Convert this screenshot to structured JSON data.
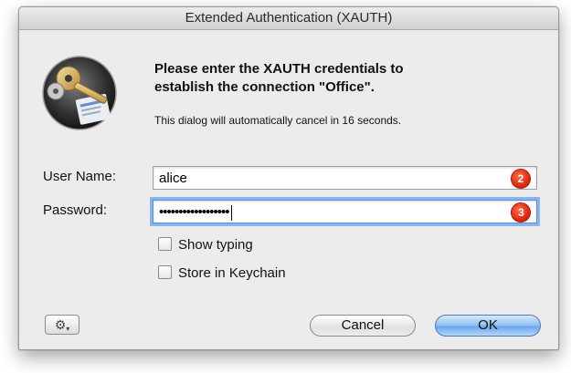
{
  "dialog": {
    "title": "Extended Authentication (XAUTH)",
    "icon": "keys-and-documents-app-icon",
    "headline_line1": "Please enter the XAUTH credentials to",
    "headline_line2": "establish the connection \"Office\".",
    "countdown_text": "This dialog will automatically cancel in 16 seconds."
  },
  "form": {
    "username_label": "User Name:",
    "username_value": "alice",
    "username_badge": "2",
    "password_label": "Password:",
    "password_masked": "••••••••••••••••••",
    "password_badge": "3",
    "show_typing_label": "Show typing",
    "show_typing_checked": false,
    "keychain_label": "Store in Keychain",
    "keychain_checked": false
  },
  "buttons": {
    "gear_icon": "gear-icon",
    "cancel_label": "Cancel",
    "ok_label": "OK"
  },
  "colors": {
    "badge": "#e0260e",
    "ok_button": "#7fb4f0",
    "focus_ring": "#8ab4ee"
  }
}
